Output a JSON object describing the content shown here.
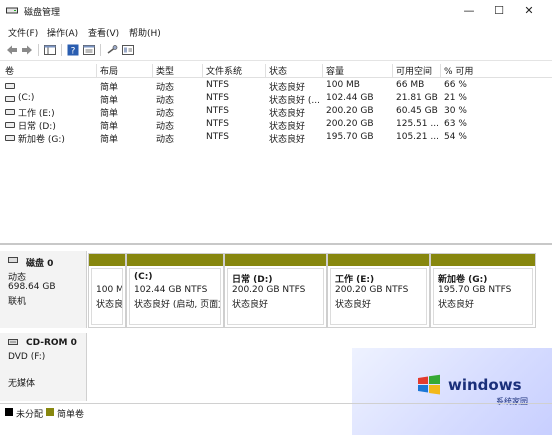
{
  "window": {
    "title": "磁盘管理",
    "minimize": "—",
    "maximize": "☐",
    "close": "✕"
  },
  "menu": [
    "文件(F)",
    "操作(A)",
    "查看(V)",
    "帮助(H)"
  ],
  "toolbar": [
    "back-arrow-icon",
    "forward-arrow-icon",
    "console-tree-icon",
    "help-icon",
    "properties-icon",
    "eject-icon",
    "view-icon"
  ],
  "volume_table": {
    "headers": [
      "卷",
      "布局",
      "类型",
      "文件系统",
      "状态",
      "容量",
      "可用空间",
      "% 可用"
    ],
    "rows": [
      [
        "",
        "简单",
        "动态",
        "NTFS",
        "状态良好",
        "100 MB",
        "66 MB",
        "66 %"
      ],
      [
        "(C:)",
        "简单",
        "动态",
        "NTFS",
        "状态良好 (...",
        "102.44 GB",
        "21.81 GB",
        "21 %"
      ],
      [
        "工作 (E:)",
        "简单",
        "动态",
        "NTFS",
        "状态良好",
        "200.20 GB",
        "60.45 GB",
        "30 %"
      ],
      [
        "日常 (D:)",
        "简单",
        "动态",
        "NTFS",
        "状态良好",
        "200.20 GB",
        "125.51 ...",
        "63 %"
      ],
      [
        "新加卷 (G:)",
        "简单",
        "动态",
        "NTFS",
        "状态良好",
        "195.70 GB",
        "105.21 ...",
        "54 %"
      ]
    ]
  },
  "disk0": {
    "name": "磁盘 0",
    "type": "动态",
    "size": "698.64 GB",
    "status": "联机",
    "partitions": [
      {
        "title": "",
        "size": "100 M",
        "status": "状态良"
      },
      {
        "title": "(C:)",
        "size": "102.44 GB NTFS",
        "status": "状态良好 (启动, 页面文"
      },
      {
        "title": "日常  (D:)",
        "size": "200.20 GB NTFS",
        "status": "状态良好"
      },
      {
        "title": "工作  (E:)",
        "size": "200.20 GB NTFS",
        "status": "状态良好"
      },
      {
        "title": "新加卷  (G:)",
        "size": "195.70 GB NTFS",
        "status": "状态良好"
      }
    ]
  },
  "cdrom0": {
    "name": "CD-ROM 0",
    "type": "DVD (F:)",
    "status": "无媒体"
  },
  "legend": [
    {
      "label": "未分配",
      "color": "#000000"
    },
    {
      "label": "简单卷",
      "color": "#87870e"
    }
  ],
  "watermark": {
    "text": "windows",
    "sub": "系统家园"
  },
  "colors": {
    "volume_bar": "#87870e",
    "unallocated": "#000000"
  }
}
